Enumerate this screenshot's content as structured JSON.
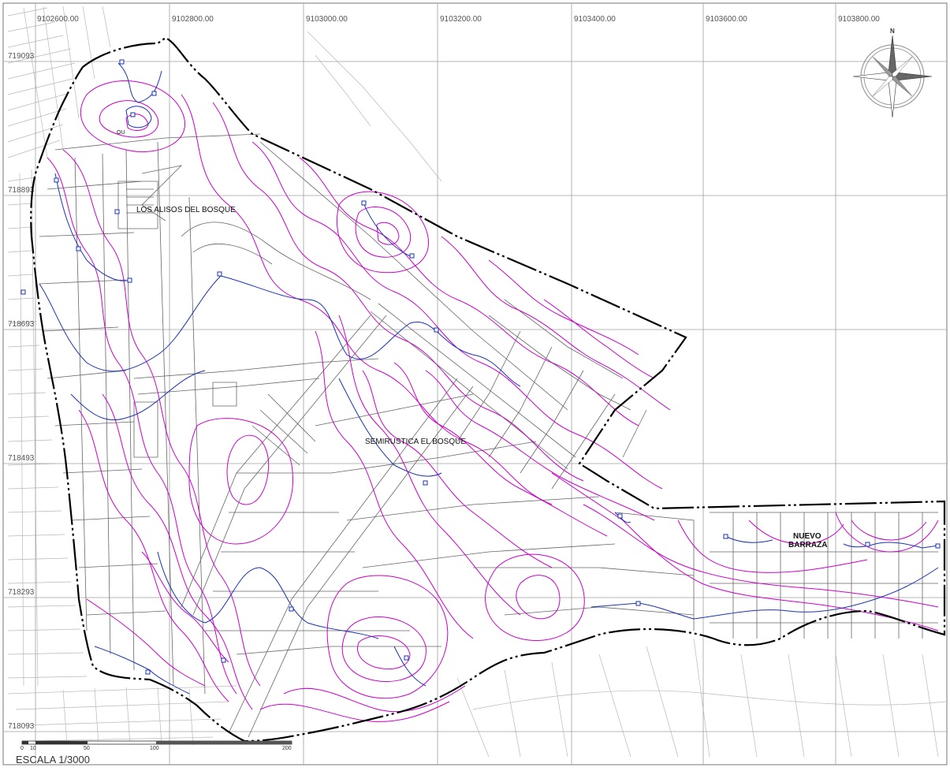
{
  "map": {
    "colors": {
      "boundary": "#000000",
      "contour_magenta": "#cc00cc",
      "contour_blue": "#1a33b3",
      "parcel": "#666666",
      "grid": "#9a9a9a",
      "background_parcel": "#b8b8b8"
    },
    "grid_x_labels": [
      "9102600.00",
      "9102800.00",
      "9103000.00",
      "9103200.00",
      "9103400.00",
      "9103600.00",
      "9103800.00"
    ],
    "grid_y_labels": [
      "719093",
      "718893",
      "718693",
      "718493",
      "718293",
      "718093"
    ],
    "places": {
      "ou": "OU",
      "los_alisos": "LOS ALISOS DEL BOSQUE",
      "semirustica": "SEMIRUSTICA EL BOSQUE",
      "nuevo_line1": "NUEVO",
      "nuevo_line2": "BARRAZA"
    },
    "compass": {
      "north_letter": "N",
      "icon": "north-arrow-compass-rose-icon"
    },
    "scale_bar": {
      "ticks": [
        "0",
        "10",
        "50",
        "100",
        "200"
      ],
      "title": "ESCALA 1/3000"
    }
  }
}
